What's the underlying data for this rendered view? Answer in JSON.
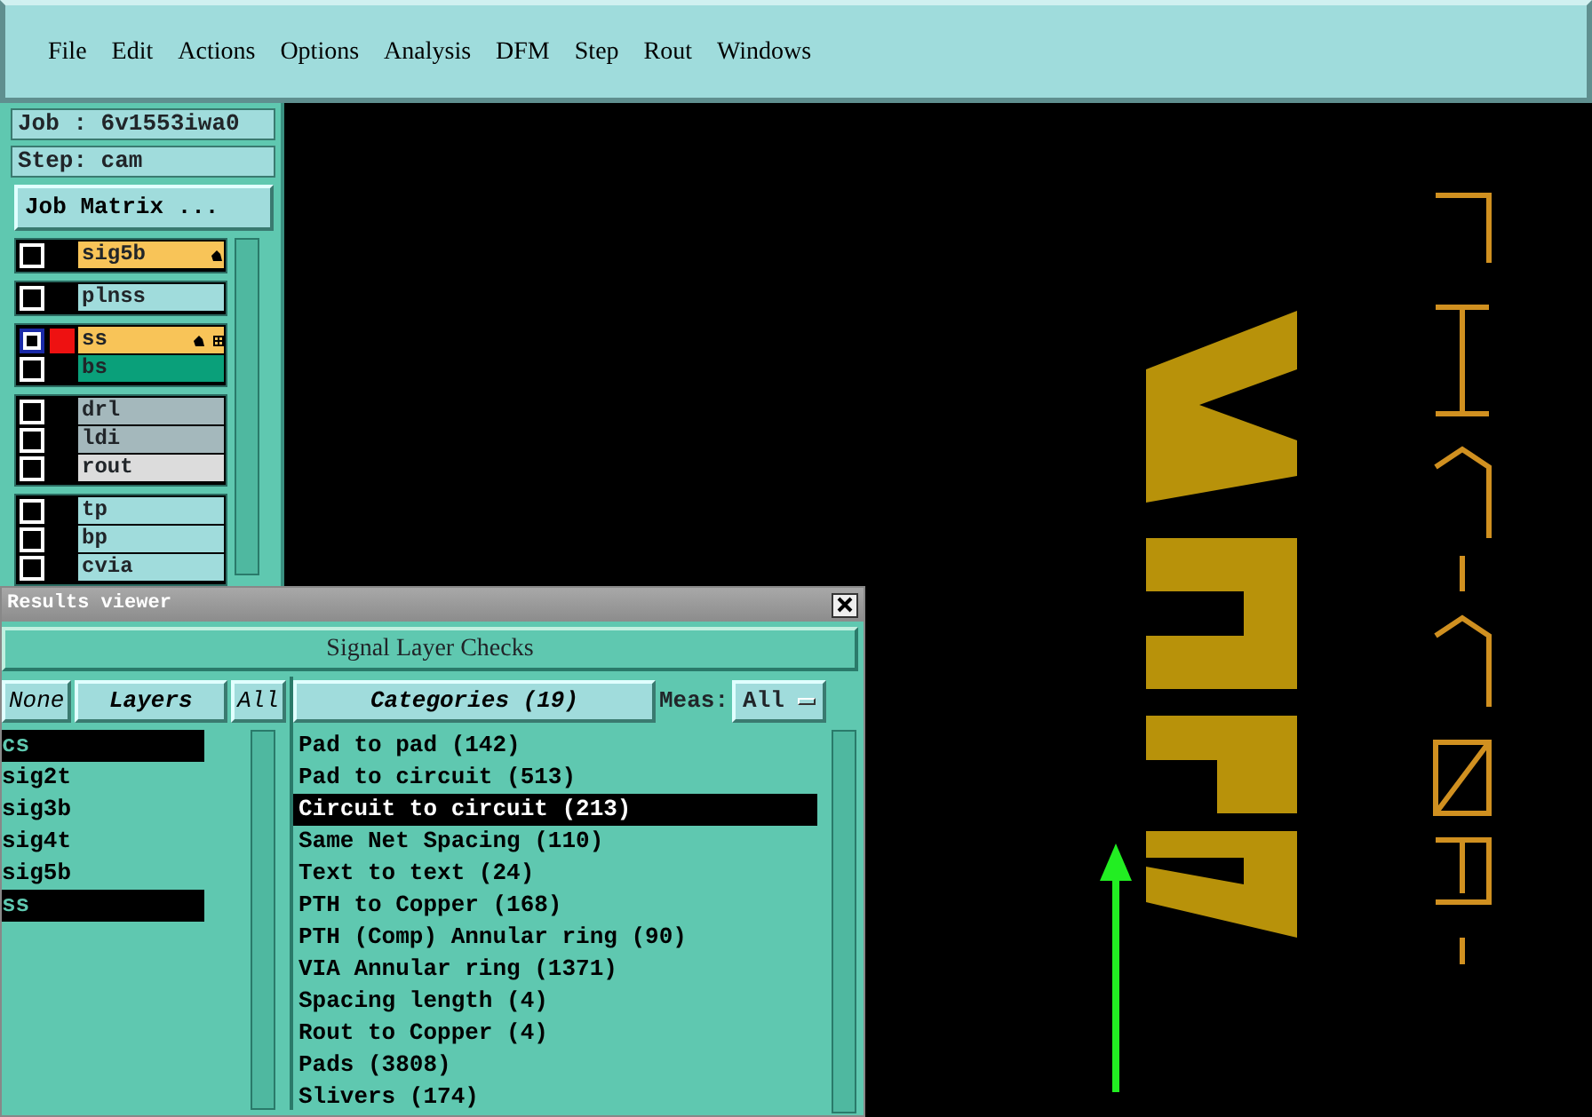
{
  "menu": [
    "File",
    "Edit",
    "Actions",
    "Options",
    "Analysis",
    "DFM",
    "Step",
    "Rout",
    "Windows"
  ],
  "job_panel": {
    "job": "Job : 6v1553iwa0",
    "step": "Step: cam",
    "matrix_button": "Job Matrix ..."
  },
  "layer_groups": [
    {
      "layers": [
        {
          "name": "sig5b",
          "color": "#f8c458",
          "selected": false,
          "flag": true,
          "affected": false
        }
      ]
    },
    {
      "layers": [
        {
          "name": "plnss",
          "color": "#a0dcdc",
          "selected": false,
          "flag": false,
          "affected": false
        }
      ]
    },
    {
      "layers": [
        {
          "name": "ss",
          "color": "#f8c458",
          "selected": true,
          "flag": true,
          "affected": true
        },
        {
          "name": "bs",
          "color": "#0aa07a",
          "selected": false,
          "flag": false,
          "affected": false
        }
      ]
    },
    {
      "layers": [
        {
          "name": "drl",
          "color": "#a4b8bc",
          "selected": false,
          "flag": false,
          "affected": false
        },
        {
          "name": "ldi",
          "color": "#a4b8bc",
          "selected": false,
          "flag": false,
          "affected": false
        },
        {
          "name": "rout",
          "color": "#dcdcdc",
          "selected": false,
          "flag": false,
          "affected": false
        }
      ]
    },
    {
      "layers": [
        {
          "name": "tp",
          "color": "#a0dcdc",
          "selected": false,
          "flag": false,
          "affected": false
        },
        {
          "name": "bp",
          "color": "#a0dcdc",
          "selected": false,
          "flag": false,
          "affected": false
        },
        {
          "name": "cvia",
          "color": "#a0dcdc",
          "selected": false,
          "flag": false,
          "affected": false
        }
      ]
    }
  ],
  "results_viewer": {
    "title": "Results viewer",
    "header": "Signal Layer Checks",
    "layer_buttons": [
      "None",
      "Layers",
      "All"
    ],
    "layer_list": [
      {
        "name": "cs",
        "selected": true
      },
      {
        "name": "sig2t",
        "selected": false
      },
      {
        "name": "sig3b",
        "selected": false
      },
      {
        "name": "sig4t",
        "selected": false
      },
      {
        "name": "sig5b",
        "selected": false
      },
      {
        "name": "ss",
        "selected": true
      }
    ],
    "categories_button": "Categories (19)",
    "meas_label": "Meas:",
    "meas_value": "All",
    "categories": [
      {
        "name": "Pad to pad (142)",
        "selected": false
      },
      {
        "name": "Pad to circuit (513)",
        "selected": false
      },
      {
        "name": "Circuit to circuit (213)",
        "selected": true
      },
      {
        "name": "Same Net Spacing (110)",
        "selected": false
      },
      {
        "name": "Text to text (24)",
        "selected": false
      },
      {
        "name": "PTH to Copper (168)",
        "selected": false
      },
      {
        "name": "PTH (Comp) Annular ring (90)",
        "selected": false
      },
      {
        "name": "VIA Annular ring (1371)",
        "selected": false
      },
      {
        "name": "Spacing length (4)",
        "selected": false
      },
      {
        "name": "Rout to Copper (4)",
        "selected": false
      },
      {
        "name": "Pads (3808)",
        "selected": false
      },
      {
        "name": "Slivers (174)",
        "selected": false
      }
    ]
  }
}
